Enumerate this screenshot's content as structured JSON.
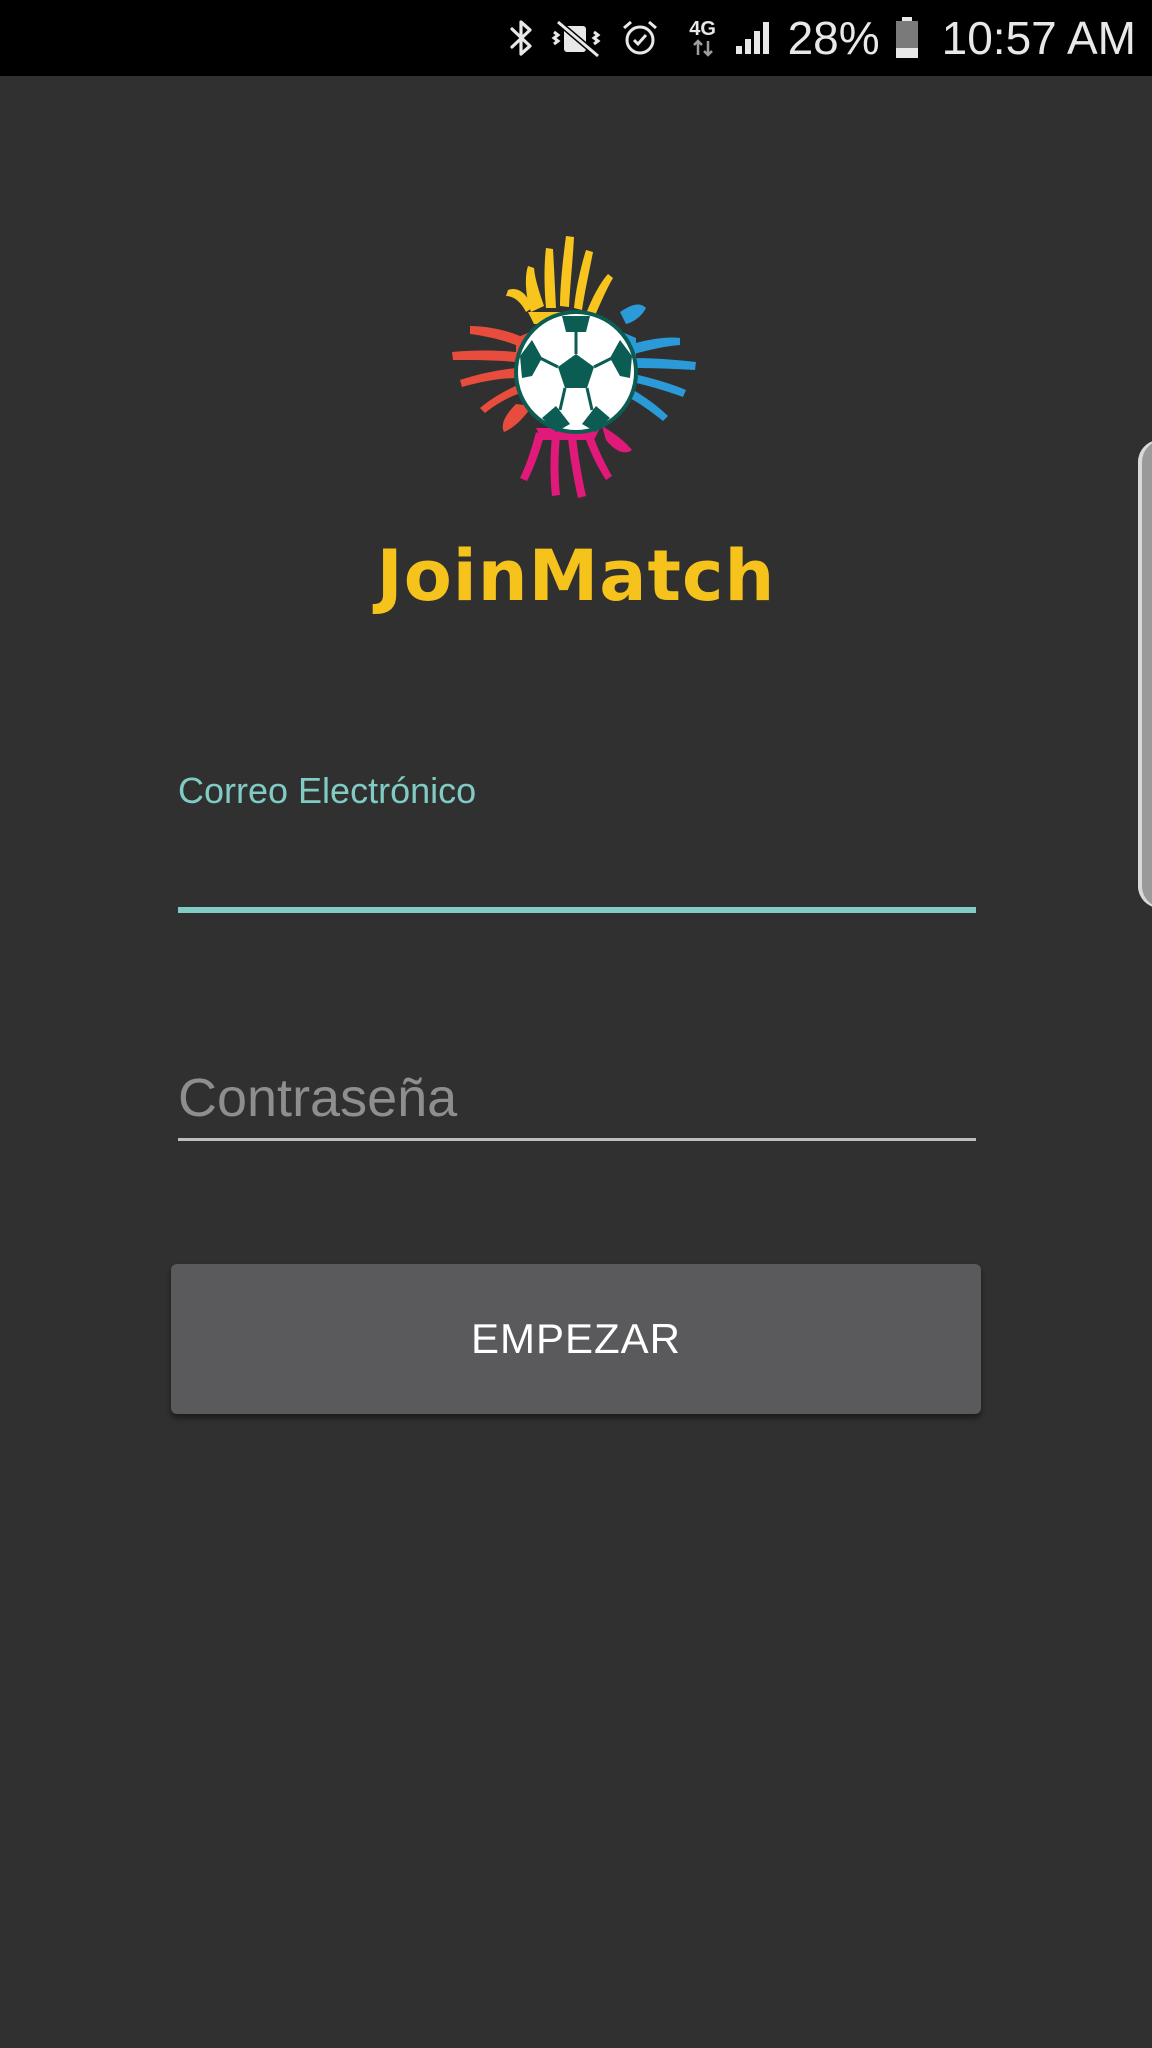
{
  "status_bar": {
    "icons": [
      "bluetooth-icon",
      "vibrate-mute-icon",
      "alarm-icon",
      "4g-data-icon",
      "signal-icon",
      "battery-icon"
    ],
    "network_label": "4G",
    "battery_percent": "28%",
    "battery_level": 0.28,
    "time": "10:57 AM"
  },
  "app": {
    "brand_name": "JoinMatch",
    "logo_icon": "joinmatch-logo-hands-soccer-ball",
    "colors": {
      "background": "#303030",
      "brand_yellow": "#f6c21c",
      "accent_teal": "#80cbc4",
      "button": "#5a5a5c",
      "hand_yellow": "#f7c51e",
      "hand_blue": "#2b9ad8",
      "hand_red": "#e84c3d",
      "hand_pink": "#e0197a",
      "ball_green": "#0b5c52"
    }
  },
  "login": {
    "email_label": "Correo Electrónico",
    "email_value": "",
    "password_placeholder": "Contraseña",
    "password_value": "",
    "submit_label": "EMPEZAR"
  }
}
